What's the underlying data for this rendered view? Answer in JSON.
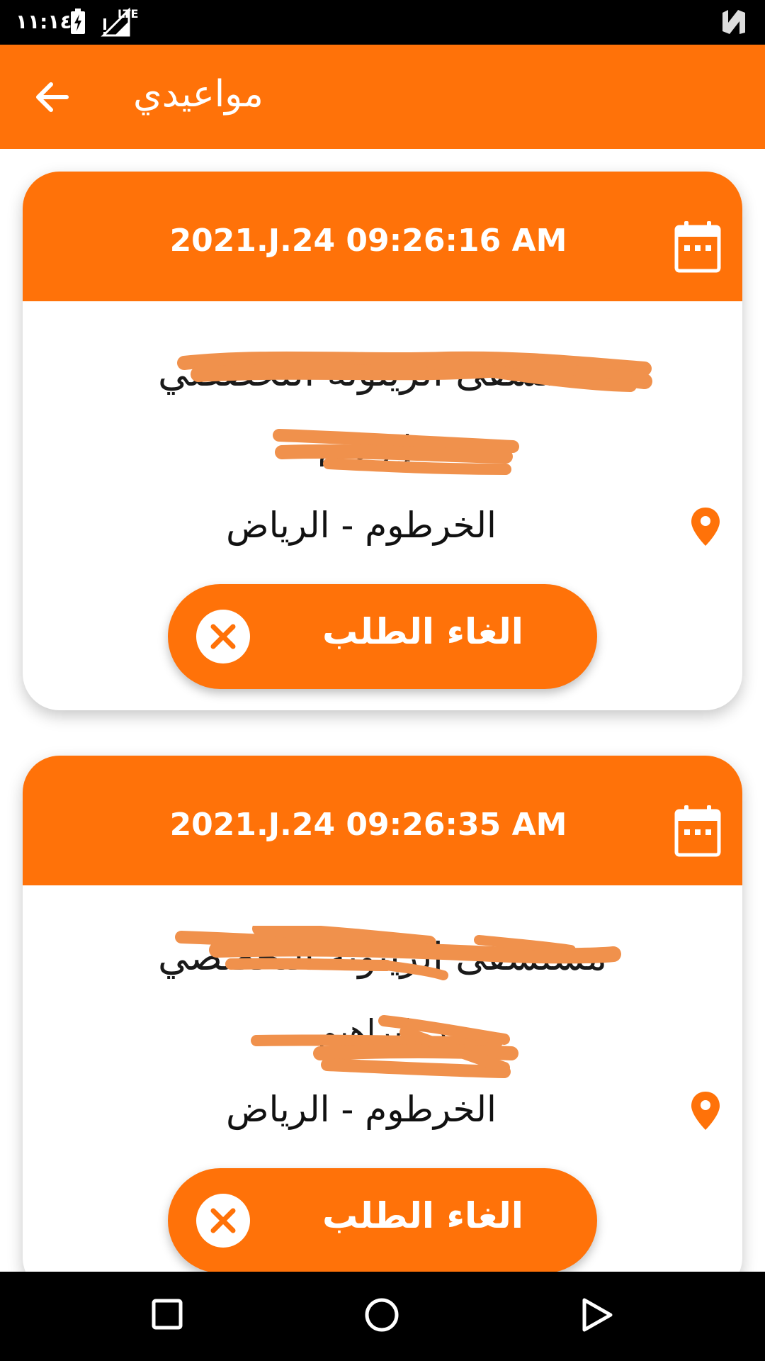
{
  "status_bar": {
    "time": "١١:١٤",
    "network": "LTE",
    "icons": [
      "battery-charging-icon",
      "signal-icon",
      "notification-n-icon"
    ]
  },
  "app_bar": {
    "title": "مواعيدي",
    "back_icon": "arrow-left-icon"
  },
  "colors": {
    "accent": "#ff7209",
    "text": "#111111",
    "redaction": "#f0914c"
  },
  "appointments": [
    {
      "datetime": "2021.J.24 09:26:16 AM",
      "hospital": "مستشفى الزيتونة التخصصي",
      "doctor": "د. إبراهيم",
      "location": "الخرطوم - الرياض",
      "cancel_label": "الغاء الطلب"
    },
    {
      "datetime": "2021.J.24 09:26:35 AM",
      "hospital": "مستشفى الزيتونة التخصصي",
      "doctor": "د. إبراهيم",
      "location": "الخرطوم - الرياض",
      "cancel_label": "الغاء الطلب"
    }
  ],
  "nav_bar": {
    "icons": [
      "recent-apps-icon",
      "home-icon",
      "back-triangle-icon"
    ]
  }
}
